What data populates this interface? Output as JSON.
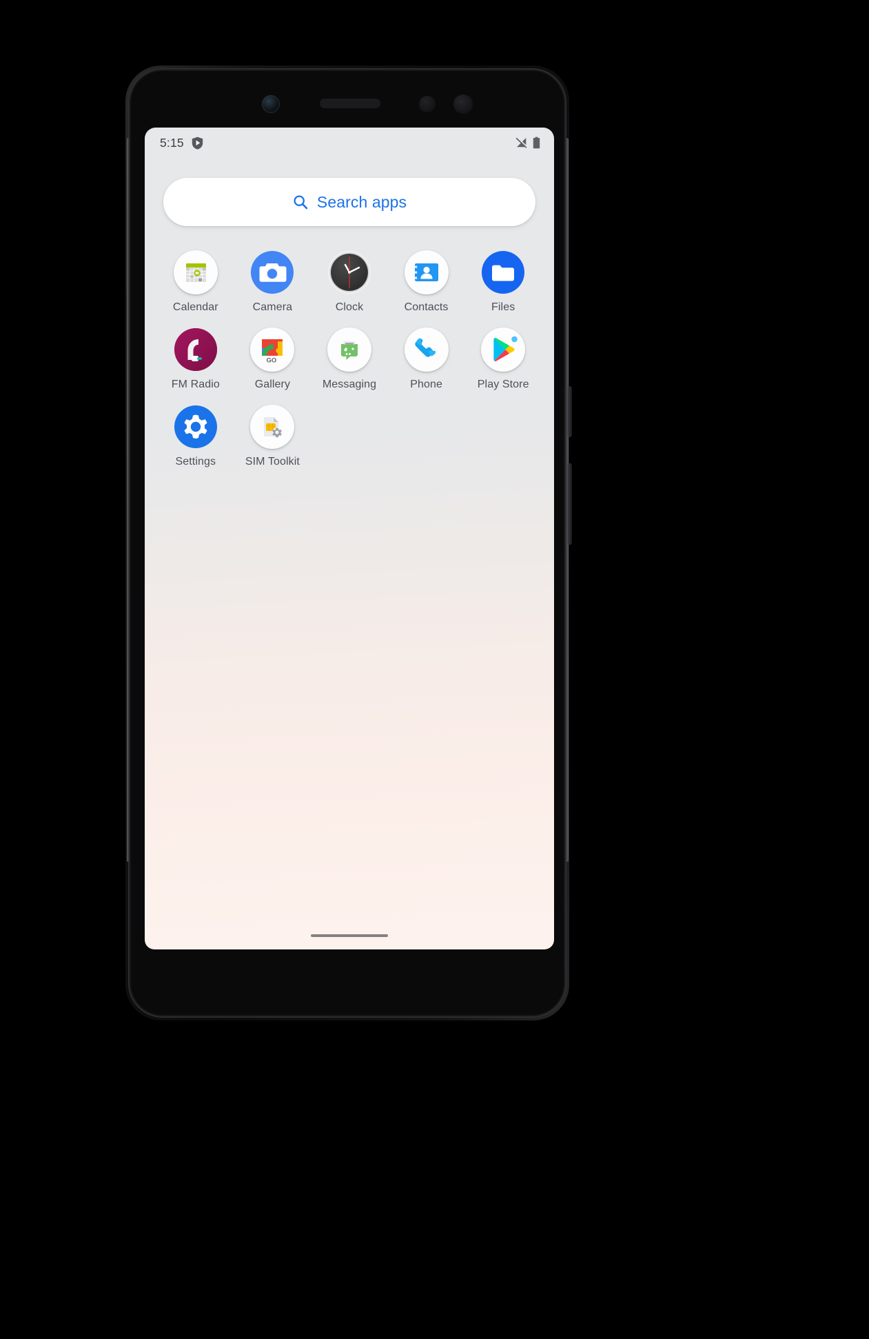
{
  "device": {
    "name": "android-phone",
    "screen_background_top": "#e6e8ea",
    "screen_background_bottom": "#fdf2ee"
  },
  "status_bar": {
    "time": "5:15",
    "left_icons": [
      {
        "name": "play-protect-shield-icon",
        "glyph": "shield"
      }
    ],
    "right_icons": [
      {
        "name": "signal-off-icon",
        "glyph": "signal-slash"
      },
      {
        "name": "battery-icon",
        "glyph": "battery-full"
      }
    ],
    "text_color": "#3d4043"
  },
  "search": {
    "placeholder": "Search apps",
    "icon": "search-icon",
    "accent_color": "#1a73e8",
    "background": "#ffffff"
  },
  "app_drawer": {
    "label_color": "#4c5156",
    "columns": 5,
    "apps": [
      {
        "label": "Calendar",
        "icon": "calendar-icon"
      },
      {
        "label": "Camera",
        "icon": "camera-icon"
      },
      {
        "label": "Clock",
        "icon": "clock-icon"
      },
      {
        "label": "Contacts",
        "icon": "contacts-icon"
      },
      {
        "label": "Files",
        "icon": "files-icon"
      },
      {
        "label": "FM Radio",
        "icon": "fm-radio-icon"
      },
      {
        "label": "Gallery",
        "icon": "gallery-icon"
      },
      {
        "label": "Messaging",
        "icon": "messaging-icon"
      },
      {
        "label": "Phone",
        "icon": "phone-icon"
      },
      {
        "label": "Play Store",
        "icon": "play-store-icon"
      },
      {
        "label": "Settings",
        "icon": "settings-icon"
      },
      {
        "label": "SIM Toolkit",
        "icon": "sim-toolkit-icon"
      }
    ]
  },
  "navigation": {
    "gesture_pill": "home-gesture-pill"
  }
}
